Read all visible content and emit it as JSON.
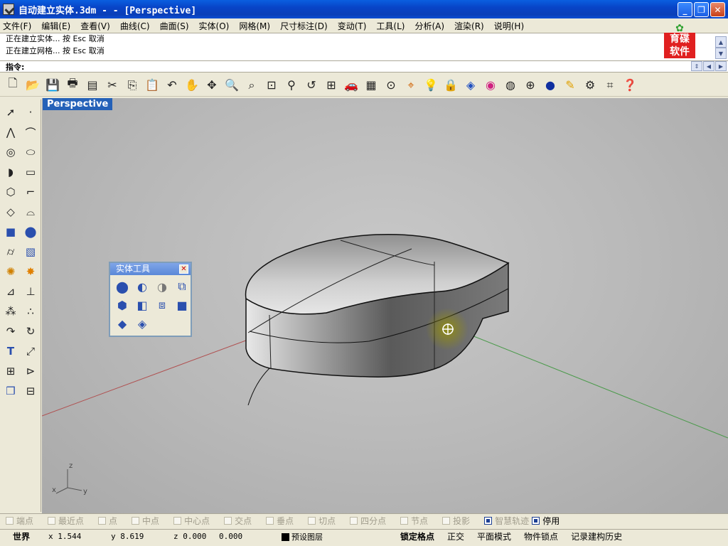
{
  "window": {
    "title": "自动建立实体.3dm -  - [Perspective]",
    "minimize": "_",
    "restore": "❐",
    "close": "✕"
  },
  "menu": [
    "文件(F)",
    "编辑(E)",
    "查看(V)",
    "曲线(C)",
    "曲面(S)",
    "实体(O)",
    "网格(M)",
    "尺寸标注(D)",
    "变动(T)",
    "工具(L)",
    "分析(A)",
    "渲染(R)",
    "说明(H)"
  ],
  "command_history": [
    "正在建立实体... 按 Esc 取消",
    "正在建立网格... 按 Esc 取消"
  ],
  "logo": {
    "line1": "育碟",
    "line2": "软件"
  },
  "prompt": {
    "label": "指令:",
    "value": ""
  },
  "toolbar_icons": [
    "new-icon",
    "open-icon",
    "save-icon",
    "print-icon",
    "properties-icon",
    "cut-icon",
    "copy-icon",
    "paste-icon",
    "undo-icon",
    "pan-icon",
    "rotate-view-icon",
    "zoom-dynamic-icon",
    "zoom-window-icon",
    "zoom-extents-icon",
    "zoom-selected-icon",
    "undo-view-icon",
    "four-viewports-icon",
    "car-icon",
    "grid-plane-icon",
    "cplane-icon",
    "osnap-icon",
    "light-icon",
    "lock-icon",
    "layer-icon",
    "color-icon",
    "wireframe-icon",
    "ghosted-icon",
    "render-sphere-icon",
    "pen-icon",
    "settings-gear-icon",
    "dimension-icon",
    "help-icon"
  ],
  "viewport": {
    "label": "Perspective"
  },
  "axis": {
    "z": "z",
    "x": "x",
    "y": "y"
  },
  "solid_tools": {
    "title": "实体工具",
    "close": "✕"
  },
  "osnaps": [
    {
      "label": "端点",
      "checked": false
    },
    {
      "label": "最近点",
      "checked": false
    },
    {
      "label": "点",
      "checked": false
    },
    {
      "label": "中点",
      "checked": false
    },
    {
      "label": "中心点",
      "checked": false
    },
    {
      "label": "交点",
      "checked": false
    },
    {
      "label": "垂点",
      "checked": false
    },
    {
      "label": "切点",
      "checked": false
    },
    {
      "label": "四分点",
      "checked": false
    },
    {
      "label": "节点",
      "checked": false
    },
    {
      "label": "投影",
      "checked": false
    },
    {
      "label": "智慧轨迹",
      "checked": true
    },
    {
      "label": "停用",
      "checked": true
    }
  ],
  "status": {
    "cplane": "世界",
    "x": "x 1.544",
    "y": "y 8.619",
    "z": "z 0.000",
    "distance": "0.000",
    "layer": "预设图层",
    "grid_snap": "锁定格点",
    "ortho": "正交",
    "planar": "平面模式",
    "object_snap": "物件锁点",
    "history": "记录建构历史"
  }
}
